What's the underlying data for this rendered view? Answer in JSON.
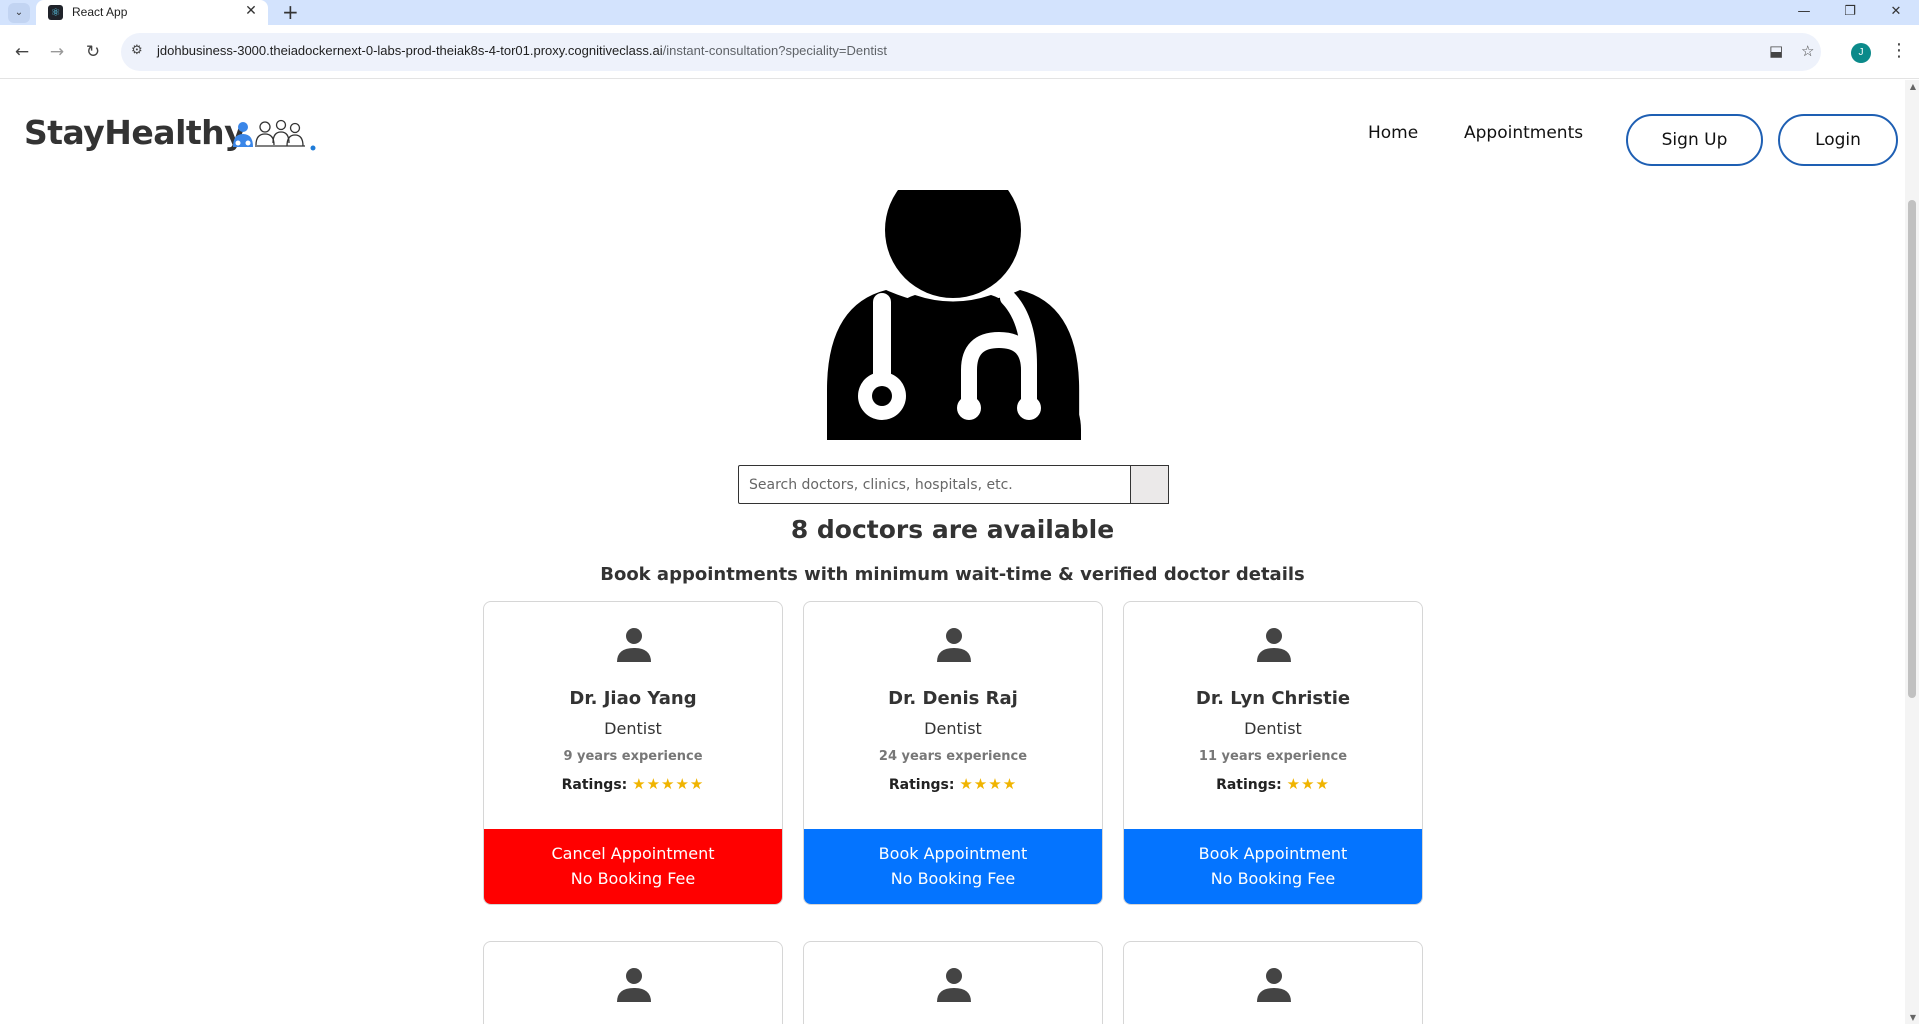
{
  "browser": {
    "tab_title": "React App",
    "url_host": "jdohbusiness-3000.theiadockernext-0-labs-prod-theiak8s-4-tor01.proxy.cognitiveclass.ai",
    "url_path": "/instant-consultation?speciality=Dentist",
    "profile_initial": "J"
  },
  "header": {
    "logo_text": "StayHealthy",
    "nav": {
      "home": "Home",
      "appointments": "Appointments"
    },
    "signup_label": "Sign Up",
    "login_label": "Login"
  },
  "search": {
    "placeholder": "Search doctors, clinics, hospitals, etc."
  },
  "results": {
    "count_text": "8 doctors are available",
    "subheading": "Book appointments with minimum wait-time & verified doctor details"
  },
  "doctors": [
    {
      "name": "Dr. Jiao Yang",
      "speciality": "Dentist",
      "experience": "9 years experience",
      "ratings_label": "Ratings:",
      "stars": "★★★★★",
      "rating": 5,
      "action": "Cancel Appointment",
      "fee": "No Booking Fee"
    },
    {
      "name": "Dr. Denis Raj",
      "speciality": "Dentist",
      "experience": "24 years experience",
      "ratings_label": "Ratings:",
      "stars": "★★★★",
      "rating": 4,
      "action": "Book Appointment",
      "fee": "No Booking Fee"
    },
    {
      "name": "Dr. Lyn Christie",
      "speciality": "Dentist",
      "experience": "11 years experience",
      "ratings_label": "Ratings:",
      "stars": "★★★",
      "rating": 3,
      "action": "Book Appointment",
      "fee": "No Booking Fee"
    }
  ],
  "colors": {
    "cancel": "#ff0000",
    "book": "#0474ff",
    "outline_button": "#1e5fb3",
    "star": "#f0b400"
  }
}
